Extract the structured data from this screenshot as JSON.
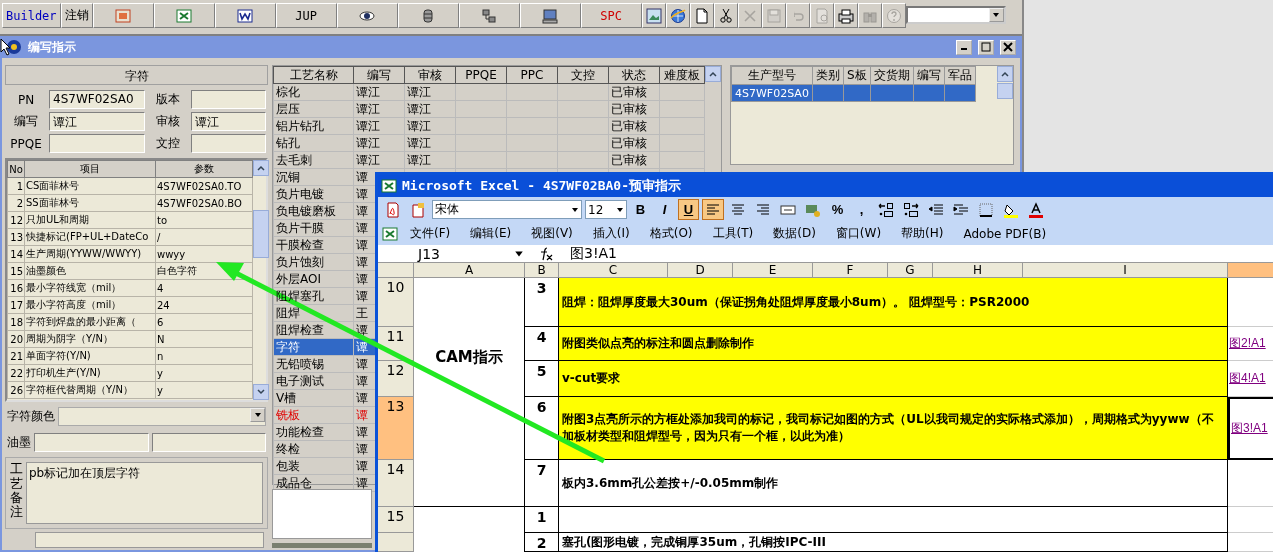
{
  "toolbar": {
    "items": [
      {
        "kind": "text",
        "label": "Builder",
        "color": "#0000c0"
      },
      {
        "kind": "text",
        "label": "注销",
        "color": "#000000"
      },
      {
        "kind": "icon",
        "disabled": false
      },
      {
        "kind": "icon",
        "disabled": false
      },
      {
        "kind": "icon",
        "disabled": false
      },
      {
        "kind": "text",
        "label": "JUP",
        "color": "#000000"
      },
      {
        "kind": "icon",
        "disabled": false
      },
      {
        "kind": "icon",
        "disabled": false
      },
      {
        "kind": "icon",
        "disabled": false
      },
      {
        "kind": "icon",
        "disabled": false
      },
      {
        "kind": "text",
        "label": "SPC",
        "color": "#d00000"
      },
      {
        "kind": "icon",
        "disabled": false
      },
      {
        "kind": "icon",
        "disabled": false
      },
      {
        "kind": "icon",
        "disabled": false
      },
      {
        "kind": "icon",
        "disabled": false
      },
      {
        "kind": "icon",
        "disabled": true
      },
      {
        "kind": "icon",
        "disabled": true
      },
      {
        "kind": "icon",
        "disabled": true
      },
      {
        "kind": "icon",
        "disabled": true
      },
      {
        "kind": "icon",
        "disabled": false
      },
      {
        "kind": "icon",
        "disabled": true
      },
      {
        "kind": "icon",
        "disabled": true
      }
    ]
  },
  "window": {
    "title": "编写指示"
  },
  "left_panel": {
    "section_title": "字符",
    "fields": [
      {
        "label": "PN",
        "value": "4S7WF02SA0"
      },
      {
        "label": "版本"
      },
      {
        "label": "编写",
        "value": "谭江"
      },
      {
        "label": "审核",
        "value": "谭江"
      },
      {
        "label": "PPQE"
      },
      {
        "label": "文控"
      }
    ],
    "grid": {
      "columns": [
        "No",
        "项目",
        "参数"
      ],
      "rows": [
        {
          "no": "1",
          "item": "CS面菲林号",
          "param": "4S7WF02SA0.TO"
        },
        {
          "no": "2",
          "item": "SS面菲林号",
          "param": "4S7WF02SA0.BO"
        },
        {
          "no": "12",
          "item": "只加UL和周期",
          "param": "to"
        },
        {
          "no": "13",
          "item": "快捷标记(FP+UL+DateCo",
          "param": "/"
        },
        {
          "no": "14",
          "item": "生产周期(YYWW/WWYY)",
          "param": "wwyy"
        },
        {
          "no": "15",
          "item": "油墨颜色",
          "param": "白色字符"
        },
        {
          "no": "16",
          "item": "最小字符线宽（mil）",
          "param": "4"
        },
        {
          "no": "17",
          "item": "最小字符高度（mil）",
          "param": "24"
        },
        {
          "no": "18",
          "item": "字符到焊盘的最小距离（",
          "param": "6"
        },
        {
          "no": "20",
          "item": "周期为阴字（Y/N）",
          "param": "N"
        },
        {
          "no": "21",
          "item": "单面字符(Y/N)",
          "param": "n"
        },
        {
          "no": "22",
          "item": "打印机生产(Y/N)",
          "param": "y"
        },
        {
          "no": "26",
          "item": "字符框代替周期（Y/N）",
          "param": "y"
        }
      ]
    },
    "color_field": {
      "label": "字符颜色"
    },
    "ink_field": {
      "label": "油墨"
    },
    "remarks": {
      "label": "工艺备注",
      "value": "pb标记加在顶层字符"
    }
  },
  "process_table": {
    "columns": [
      "工艺名称",
      "编写",
      "审核",
      "PPQE",
      "PPC",
      "文控",
      "状态",
      "难度板"
    ],
    "rows": [
      {
        "name": "棕化",
        "writer": "谭江",
        "reviewer": "谭江",
        "status": "已审核",
        "selected": false,
        "warning": false
      },
      {
        "name": "层压",
        "writer": "谭江",
        "reviewer": "谭江",
        "status": "已审核",
        "selected": false,
        "warning": false
      },
      {
        "name": "铝片钻孔",
        "writer": "谭江",
        "reviewer": "谭江",
        "status": "已审核",
        "selected": false,
        "warning": false
      },
      {
        "name": "钻孔",
        "writer": "谭江",
        "reviewer": "谭江",
        "status": "已审核",
        "selected": false,
        "warning": false
      },
      {
        "name": "去毛刺",
        "writer": "谭江",
        "reviewer": "谭江",
        "status": "已审核",
        "selected": false,
        "warning": false
      },
      {
        "name": "沉铜",
        "writer": "谭",
        "selected": false,
        "warning": false
      },
      {
        "name": "负片电镀",
        "writer": "谭",
        "selected": false,
        "warning": false
      },
      {
        "name": "负电镀磨板",
        "writer": "谭",
        "selected": false,
        "warning": false
      },
      {
        "name": "负片干膜",
        "writer": "谭",
        "selected": false,
        "warning": false
      },
      {
        "name": "干膜检查",
        "writer": "谭",
        "selected": false,
        "warning": false
      },
      {
        "name": "负片蚀刻",
        "writer": "谭",
        "selected": false,
        "warning": false
      },
      {
        "name": "外层AOI",
        "writer": "谭",
        "selected": false,
        "warning": false
      },
      {
        "name": "阻焊塞孔",
        "writer": "谭",
        "selected": false,
        "warning": false
      },
      {
        "name": "阻焊",
        "writer": "王",
        "selected": false,
        "warning": false
      },
      {
        "name": "阻焊检查",
        "writer": "谭",
        "selected": false,
        "warning": false
      },
      {
        "name": "字符",
        "writer": "谭",
        "selected": true,
        "warning": false
      },
      {
        "name": "无铅喷锡",
        "writer": "谭",
        "selected": false,
        "warning": false
      },
      {
        "name": "电子测试",
        "writer": "谭",
        "selected": false,
        "warning": false
      },
      {
        "name": "V槽",
        "writer": "谭",
        "selected": false,
        "warning": false
      },
      {
        "name": "铣板",
        "writer": "谭",
        "selected": false,
        "warning": true
      },
      {
        "name": "功能检查",
        "writer": "谭",
        "selected": false,
        "warning": false
      },
      {
        "name": "终检",
        "writer": "谭",
        "selected": false,
        "warning": false
      },
      {
        "name": "包装",
        "writer": "谭",
        "selected": false,
        "warning": false
      },
      {
        "name": "成品仓",
        "writer": "谭",
        "selected": false,
        "warning": false
      }
    ]
  },
  "order_table": {
    "columns": [
      "生产型号",
      "类别",
      "S板",
      "交货期",
      "编写",
      "军品"
    ],
    "rows": [
      {
        "model": "4S7WF02SA0",
        "selected": true
      }
    ]
  },
  "excel": {
    "title": "Microsoft Excel - 4S7WF02BA0-预审指示",
    "font": "宋体",
    "size": "12",
    "format_buttons": [
      {
        "label": "B",
        "pressed": false
      },
      {
        "label": "I",
        "pressed": false
      },
      {
        "label": "U",
        "pressed": true
      }
    ],
    "align_buttons": [
      {
        "selected": true
      },
      {
        "selected": false
      },
      {
        "selected": false
      }
    ],
    "number_buttons": [
      "%",
      ","
    ],
    "menu": [
      "文件(F)",
      "编辑(E)",
      "视图(V)",
      "插入(I)",
      "格式(O)",
      "工具(T)",
      "数据(D)",
      "窗口(W)",
      "帮助(H)",
      "Adobe PDF(B)"
    ],
    "name_box": "J13",
    "formula": "图3!A1",
    "columns": [
      {
        "label": "A",
        "selected": false
      },
      {
        "label": "B",
        "selected": false
      },
      {
        "label": "C",
        "selected": false
      },
      {
        "label": "D",
        "selected": false
      },
      {
        "label": "E",
        "selected": false
      },
      {
        "label": "F",
        "selected": false
      },
      {
        "label": "G",
        "selected": false
      },
      {
        "label": "H",
        "selected": false
      },
      {
        "label": "I",
        "selected": false
      },
      {
        "selected": true
      }
    ],
    "sections": [
      {
        "label": "CAM指示",
        "rows": [
          {
            "header": "10",
            "selected": false,
            "no": "3",
            "text": "阻焊：阻焊厚度最大30um（保证拐角处阻焊厚度最小8um）。 阻焊型号：PSR2000",
            "highlight": true
          },
          {
            "header": "11",
            "selected": false,
            "no": "4",
            "text": "附图类似点亮的标注和圆点删除制作",
            "highlight": true,
            "link": "图2!A1",
            "active_link": false
          },
          {
            "header": "12",
            "selected": false,
            "no": "5",
            "text": "v-cut要求",
            "highlight": true,
            "link": "图4!A1",
            "active_link": false
          },
          {
            "header": "13",
            "selected": true,
            "no": "6",
            "text": "附图3点亮所示的方框处添加我司的标记，我司标记如图的方式（UL以我司规定的实际格式添加），周期格式为yyww（不加板材类型和阻焊型号，因为只有一个框，以此为准）",
            "highlight": true,
            "link": "图3!A1",
            "active_link": true
          },
          {
            "header": "14",
            "selected": false,
            "no": "7",
            "text": "板内3.6mm孔公差按+/-0.05mm制作",
            "highlight": false
          }
        ]
      },
      {
        "rows": [
          {
            "header": "15",
            "selected": false,
            "no": "1",
            "highlight": false
          },
          {
            "selected": false,
            "no": "2",
            "text": "塞孔(图形电镀，完成铜厚35um，孔铜按IPC-III",
            "highlight": false
          }
        ]
      }
    ]
  }
}
